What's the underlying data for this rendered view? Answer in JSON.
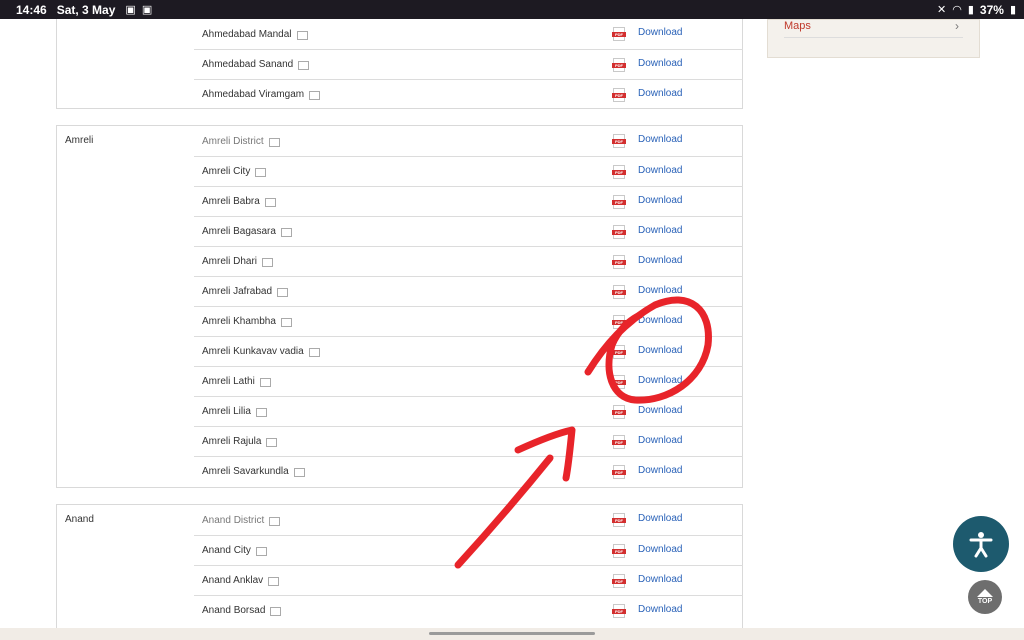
{
  "status_bar": {
    "time": "14:46",
    "date": "Sat, 3 May",
    "battery": "37%"
  },
  "sidebar": {
    "maps_label": "Maps",
    "chevron": "›"
  },
  "common": {
    "download_label": "Download"
  },
  "groups": [
    {
      "district": "",
      "rows": [
        {
          "name": "Ahmedabad Mandal"
        },
        {
          "name": "Ahmedabad Sanand"
        },
        {
          "name": "Ahmedabad Viramgam"
        }
      ]
    },
    {
      "district": "Amreli",
      "rows": [
        {
          "name": "Amreli District"
        },
        {
          "name": "Amreli City"
        },
        {
          "name": "Amreli Babra"
        },
        {
          "name": "Amreli Bagasara"
        },
        {
          "name": "Amreli Dhari"
        },
        {
          "name": "Amreli Jafrabad"
        },
        {
          "name": "Amreli Khambha"
        },
        {
          "name": "Amreli Kunkavav vadia"
        },
        {
          "name": "Amreli Lathi"
        },
        {
          "name": "Amreli Lilia"
        },
        {
          "name": "Amreli Rajula"
        },
        {
          "name": "Amreli Savarkundla"
        }
      ]
    },
    {
      "district": "Anand",
      "rows": [
        {
          "name": "Anand District"
        },
        {
          "name": "Anand City"
        },
        {
          "name": "Anand Anklav"
        },
        {
          "name": "Anand Borsad"
        }
      ]
    }
  ],
  "floating": {
    "top_label": "TOP"
  },
  "colors": {
    "link": "#2a62b8",
    "annotation": "#e8242a",
    "accessibility_button": "#1d5a6e"
  }
}
